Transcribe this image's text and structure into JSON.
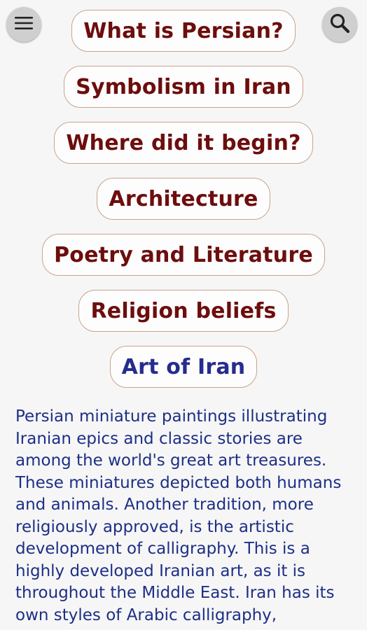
{
  "header": {
    "menu_icon": "hamburger-menu-icon",
    "search_icon": "search-icon"
  },
  "topics": [
    {
      "label": "What is Persian?"
    },
    {
      "label": "Symbolism in Iran"
    },
    {
      "label": "Where did it begin?"
    },
    {
      "label": "Architecture"
    },
    {
      "label": "Poetry and Literature"
    },
    {
      "label": "Religion beliefs"
    },
    {
      "label": "Art of Iran"
    }
  ],
  "selected_topic": "Art of Iran",
  "article": {
    "text": "Persian miniature paintings illustrating Iranian epics and classic stories are among the world's great art treasures. These miniatures depicted both humans and animals. Another tradition, more religiously approved, is the artistic development of calligraphy. This is a highly developed Iranian art, as it is throughout the Middle East. Iran has its own styles of Arabic calligraphy,"
  },
  "colors": {
    "background": "#f6f6f6",
    "topic_text": "#6d0d0d",
    "topic_selected_text": "#262c8e",
    "topic_border": "#c9a48c",
    "article_text": "#1d2f86",
    "round_button": "#cfcfcf"
  }
}
